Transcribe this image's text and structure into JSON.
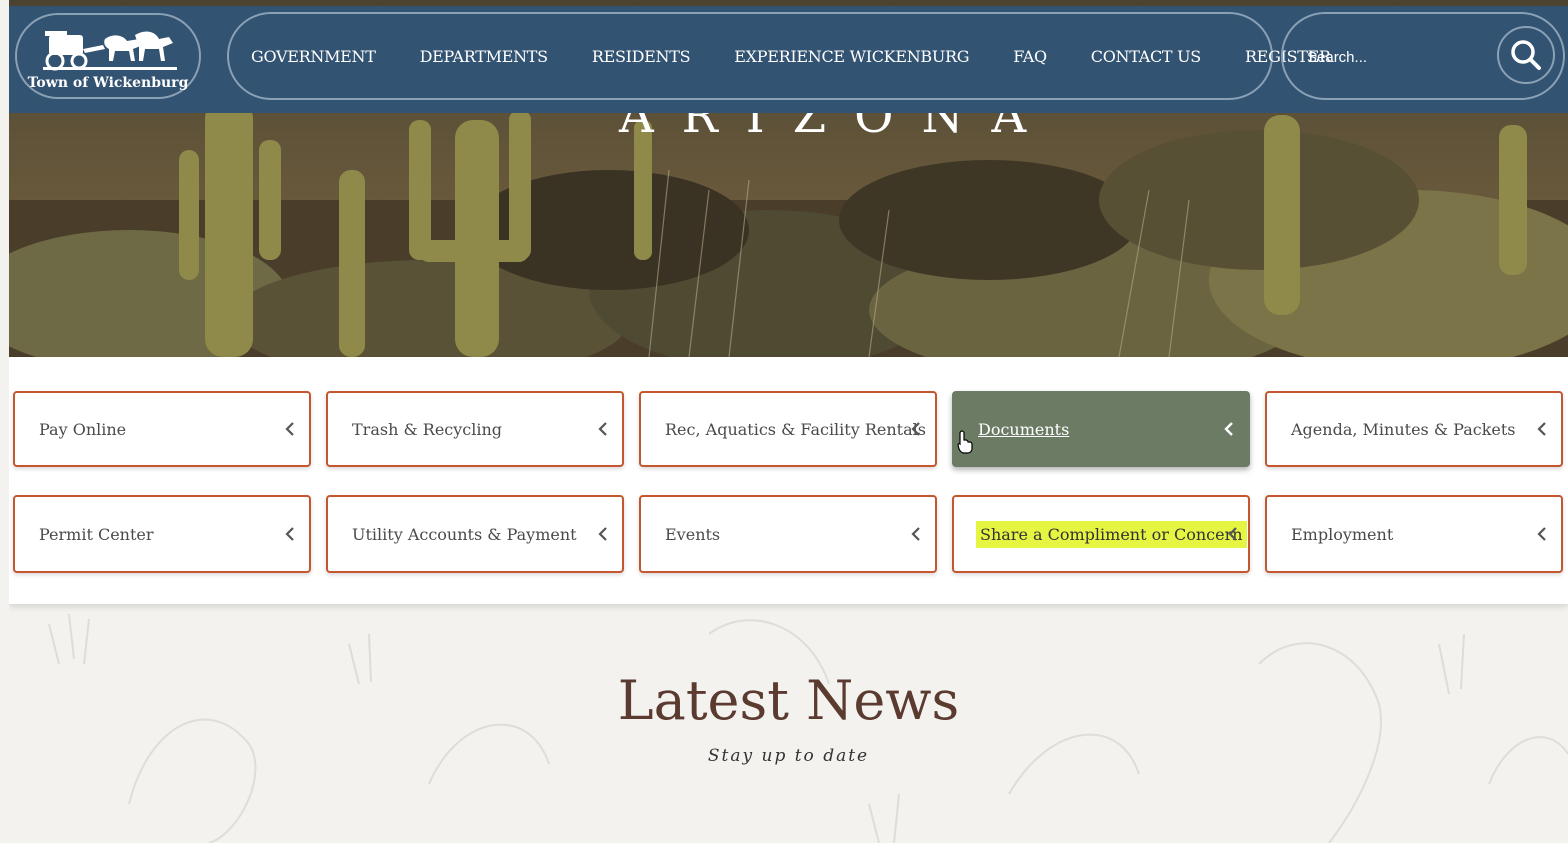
{
  "header": {
    "logo_text": "Town of Wickenburg",
    "nav": [
      {
        "label": "GOVERNMENT"
      },
      {
        "label": "DEPARTMENTS"
      },
      {
        "label": "RESIDENTS"
      },
      {
        "label": "EXPERIENCE WICKENBURG"
      },
      {
        "label": "FAQ"
      },
      {
        "label": "CONTACT US"
      },
      {
        "label": "REGISTER"
      }
    ],
    "search_placeholder": "Search..."
  },
  "hero": {
    "title": "ARIZONA"
  },
  "quick_links": [
    {
      "label": "Pay Online"
    },
    {
      "label": "Trash & Recycling"
    },
    {
      "label": "Rec, Aquatics & Facility Rentals"
    },
    {
      "label": "Documents",
      "state": "hovered"
    },
    {
      "label": "Agenda, Minutes & Packets"
    },
    {
      "label": "Permit Center"
    },
    {
      "label": "Utility Accounts & Payment"
    },
    {
      "label": "Events"
    },
    {
      "label": "Share a Compliment or Concern",
      "state": "highlighted"
    },
    {
      "label": "Employment"
    }
  ],
  "news": {
    "title": "Latest News",
    "subtitle": "Stay up to date"
  },
  "colors": {
    "header_bg": "#335372",
    "card_border": "#c4572f",
    "card_hover_bg": "#6b7b64",
    "highlight": "#e6f542",
    "news_title": "#5b3a30"
  }
}
